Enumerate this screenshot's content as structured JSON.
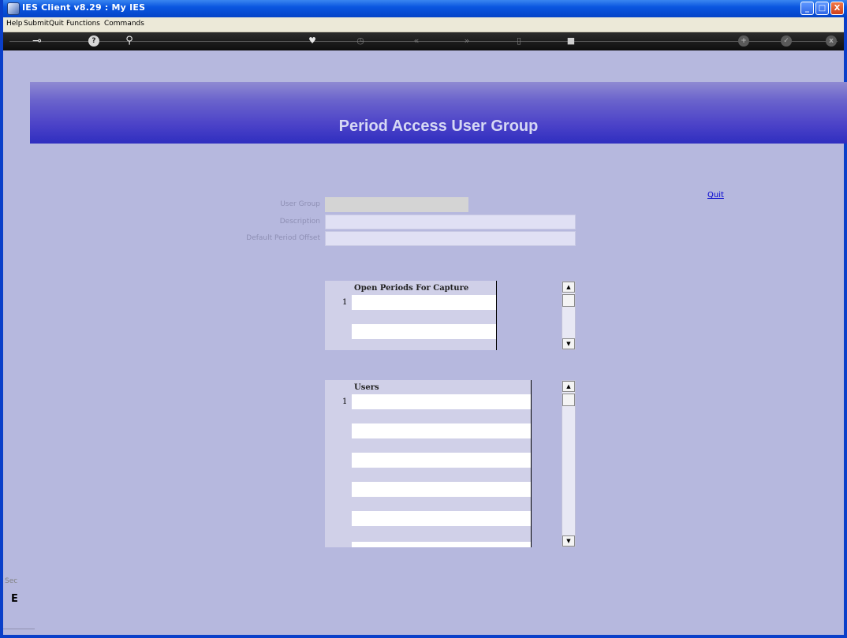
{
  "window": {
    "title": "IES Client v8.29 : My IES",
    "controls": {
      "minimize": "_",
      "maximize": "□",
      "close": "X"
    }
  },
  "menu": [
    "Help",
    "Submit",
    "Quit",
    "Functions",
    "Commands"
  ],
  "toolbar": {
    "items": [
      {
        "name": "key-icon",
        "glyph": "⊸",
        "enabled": true
      },
      {
        "name": "help-icon",
        "glyph": "?",
        "enabled": true
      },
      {
        "name": "search-icon",
        "glyph": "🔍",
        "enabled": true
      },
      {
        "name": "heart-icon",
        "glyph": "♥",
        "enabled": true
      },
      {
        "name": "clock-icon",
        "glyph": "◷",
        "enabled": false
      },
      {
        "name": "rewind-icon",
        "glyph": "«",
        "enabled": false
      },
      {
        "name": "forward-icon",
        "glyph": "»",
        "enabled": false
      },
      {
        "name": "document-icon",
        "glyph": "▯",
        "enabled": false
      },
      {
        "name": "stop-icon",
        "glyph": "■",
        "enabled": false
      },
      {
        "name": "add-icon",
        "glyph": "+",
        "enabled": false
      },
      {
        "name": "accept-icon",
        "glyph": "✓",
        "enabled": false
      },
      {
        "name": "cancel-icon",
        "glyph": "x",
        "enabled": false
      }
    ]
  },
  "page": {
    "title": "Period Access User Group",
    "quit_label": "Quit"
  },
  "form": {
    "user_group": {
      "label": "User Group",
      "value": ""
    },
    "description": {
      "label": "Description",
      "value": ""
    },
    "default_period_offset": {
      "label": "Default Period Offset",
      "value": ""
    }
  },
  "periods_grid": {
    "header": "Open Periods For Capture",
    "first_row_number": "1",
    "rows": [
      "",
      "",
      ""
    ]
  },
  "users_grid": {
    "header": "Users",
    "first_row_number": "1",
    "rows": [
      "",
      "",
      "",
      "",
      "",
      "",
      "",
      "",
      "",
      ""
    ]
  },
  "status": {
    "text": "Sec",
    "indicator": "E"
  },
  "colors": {
    "titlebar": "#0a56e0",
    "content_bg": "#b6b8de",
    "banner": "#4b42c8",
    "banner_text": "#d6d8f4",
    "link": "#0000d0"
  }
}
